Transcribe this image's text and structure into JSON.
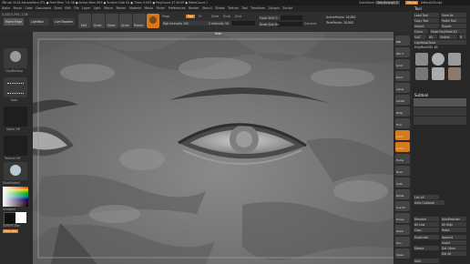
{
  "titlebar": {
    "title": "ZBrush 2018    AstraliaFace.ZTL    ● Free Mem 7.6 GB ● Active Mem 895 ● Scratch Disk 62 ● Timer 0.003 ● PolyCount 47.56 KP ● MeshCount 1",
    "quicksave": "QuickSave",
    "seethrough": "See-through 0",
    "menus": "Menus",
    "defaultscript": "DefaultZScript"
  },
  "menubar": {
    "items": [
      "Alpha",
      "Brush",
      "Color",
      "Document",
      "Draw",
      "Edit",
      "File",
      "Layer",
      "Light",
      "Macro",
      "Marker",
      "Material",
      "Movie",
      "Picker",
      "Preferences",
      "Render",
      "Stencil",
      "Stroke",
      "Texture",
      "Tool",
      "Transform",
      "Zplugin",
      "Zscript"
    ],
    "coords": "0.440,0.294,-1.08"
  },
  "left_shelf": {
    "home_page": "Home Page",
    "lightbox": "LightBox",
    "live_boolean": "Live Boolean",
    "brush_label": "ClayBuildup",
    "stroke_label": "Dots",
    "alpha_label": "Alpha Off",
    "texture_label": "Texture Off",
    "material_label": "SkinShade4",
    "gradient": "Gradient",
    "switch_color": "SwitchColor",
    "alternate": "Alternate"
  },
  "toolbar": {
    "edit": "Edit",
    "draw": "Draw",
    "move": "Move",
    "scale": "Scale",
    "rotate": "Rotate",
    "mrgb": "Mrgb",
    "rgb": "Rgb",
    "m": "M",
    "zadd": "Zadd",
    "zsub": "Zsub",
    "zcut": "Zcut",
    "rgb_intensity": "Rgb Intensity 100",
    "z_intensity": "Z Intensity 50",
    "focal_shift": "Focal Shift 0",
    "draw_size": "Draw Size 64",
    "dynamic": "Dynamic",
    "active_points": "ActivePoints: 28,882",
    "total_points": "TotalPoints: 28,882"
  },
  "viewport": {
    "top_label": "Hide"
  },
  "right_shelf": {
    "items": [
      "BPR",
      "SPix 3",
      "Scroll",
      "Zoom",
      "Actual",
      "AAHalf",
      "Persp",
      "Floor",
      "Local",
      "Gizmo",
      "Frame",
      "Move",
      "Scale",
      "Rotate",
      "Line Fill",
      "Transp",
      "Ghost",
      "Solo",
      "Xpose"
    ]
  },
  "tool_palette": {
    "title": "Tool",
    "load_tool": "Load Tool",
    "save_as": "Save As",
    "copy_tool": "Copy Tool",
    "paste_tool": "Paste Tool",
    "import": "Import",
    "export": "Export",
    "clone": "Clone",
    "make_polymesh": "Make PolyMesh3D",
    "goz": "GoZ",
    "all": "All",
    "visible": "Visible",
    "r": "R",
    "lightbox_tools": "Lightbox▸Tools",
    "current_tool": "PolyMesh3D: 48",
    "subtool": "Subtool",
    "list_all": "List All",
    "auto_collapse": "Auto Collapse",
    "rename": "Rename",
    "autoreorder": "AutoReorder",
    "all_low": "All Low",
    "all_high": "All High",
    "copy": "Copy",
    "paste": "Paste",
    "duplicate": "Duplicate",
    "append": "Append",
    "insert": "Insert",
    "delete": "Delete",
    "del_other": "Del Other",
    "del_all": "Del All",
    "split": "Split"
  },
  "colors": {
    "accent": "#d77a1e",
    "panel": "#2b2b2b",
    "viewport": "#777777"
  }
}
